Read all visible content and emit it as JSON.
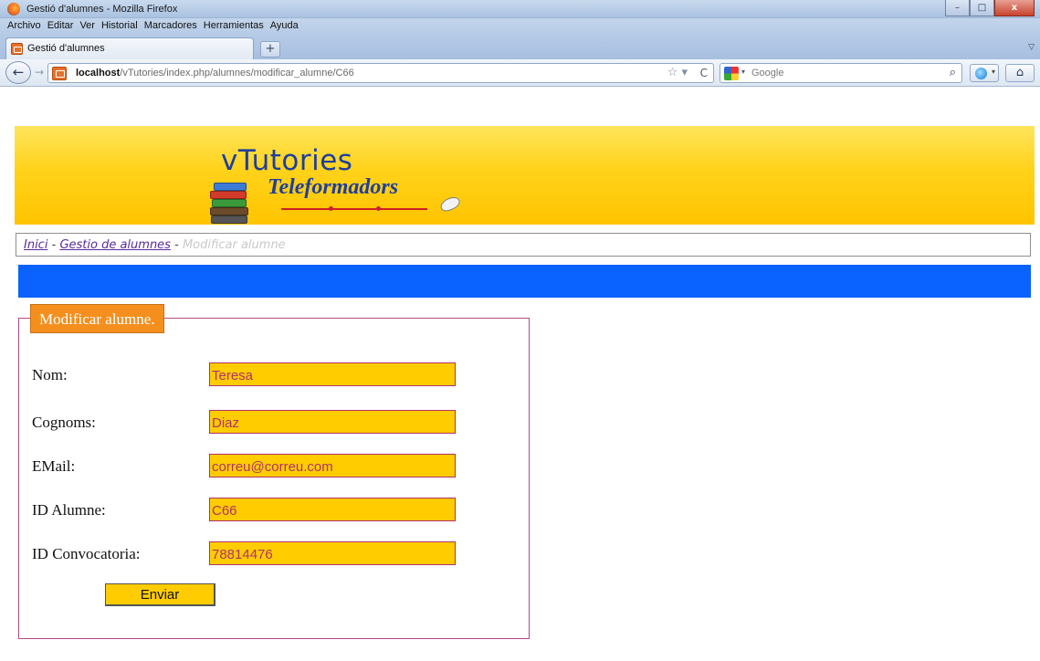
{
  "window": {
    "title": "Gestió d'alumnes - Mozilla Firefox",
    "controls": {
      "minimize": "–",
      "maximize": "□",
      "close": "x"
    }
  },
  "menu": {
    "items": [
      "Archivo",
      "Editar",
      "Ver",
      "Historial",
      "Marcadores",
      "Herramientas",
      "Ayuda"
    ]
  },
  "tab": {
    "title": "Gestió d'alumnes",
    "new_tab_label": "+"
  },
  "nav": {
    "back_glyph": "←",
    "forward_glyph": "→",
    "url_host": "localhost",
    "url_path": "/vTutories/index.php/alumnes/modificar_alumne/C66",
    "star_glyph": "☆ ▾",
    "reload_glyph": "C",
    "search_placeholder": "Google",
    "search_go_glyph": "⌕",
    "home_glyph": "⌂"
  },
  "header": {
    "logo_title": "vTutories",
    "logo_subtitle": "Teleformadors"
  },
  "breadcrumb": {
    "home": "Inici",
    "section": "Gestio de alumnes",
    "separator": "-",
    "current": "Modificar alumne"
  },
  "form": {
    "legend": "Modificar alumne.",
    "fields": [
      {
        "label": "Nom:",
        "value": "Teresa"
      },
      {
        "label": "Cognoms:",
        "value": "Diaz"
      },
      {
        "label": "EMail:",
        "value": "correu@correu.com"
      },
      {
        "label": "ID Alumne:",
        "value": "C66"
      },
      {
        "label": "ID Convocatoria:",
        "value": "78814476"
      }
    ],
    "submit_label": "Enviar"
  },
  "colors": {
    "banner": "#ffd21a",
    "nav_bar": "#0a62ff",
    "legend_bg": "#f48f1e",
    "input_bg": "#ffcc00",
    "input_border": "#b0326a",
    "fieldset_border": "#b04a85",
    "link": "#5a2a9e"
  }
}
